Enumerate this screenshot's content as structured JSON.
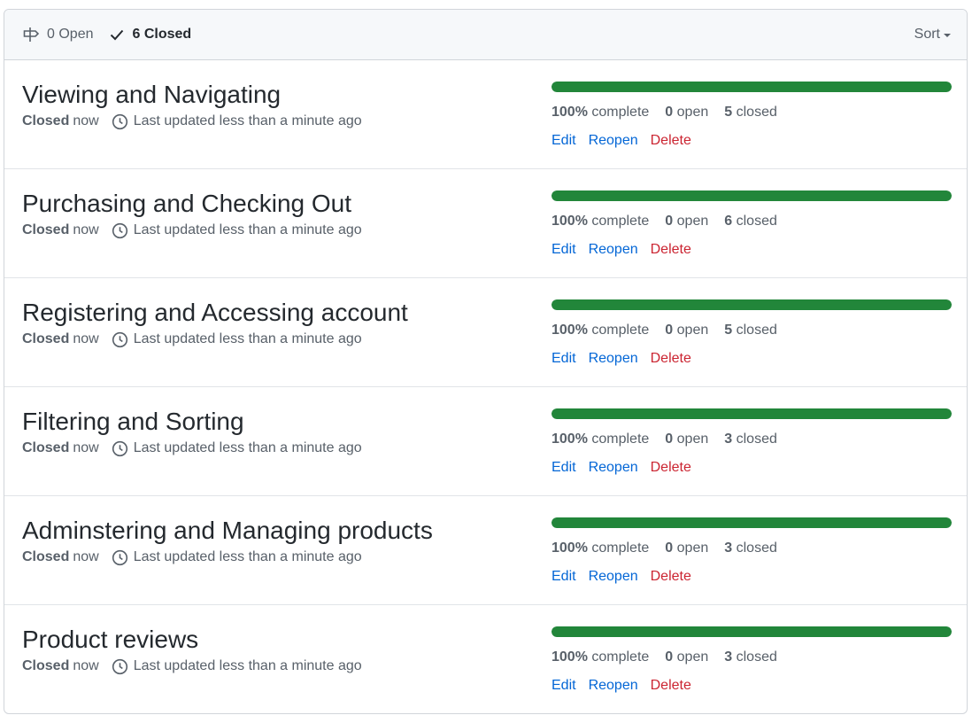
{
  "header": {
    "open_label": "0 Open",
    "closed_label": "6 Closed",
    "sort_label": "Sort"
  },
  "milestones": [
    {
      "title": "Viewing and Navigating",
      "state": "Closed",
      "when": "now",
      "updated": "Last updated less than a minute ago",
      "percent": "100%",
      "percent_word": "complete",
      "open": "0",
      "open_word": "open",
      "closed": "5",
      "closed_word": "closed",
      "progress": 1.0,
      "edit": "Edit",
      "reopen": "Reopen",
      "delete": "Delete"
    },
    {
      "title": "Purchasing and Checking Out",
      "state": "Closed",
      "when": "now",
      "updated": "Last updated less than a minute ago",
      "percent": "100%",
      "percent_word": "complete",
      "open": "0",
      "open_word": "open",
      "closed": "6",
      "closed_word": "closed",
      "progress": 1.0,
      "edit": "Edit",
      "reopen": "Reopen",
      "delete": "Delete"
    },
    {
      "title": "Registering and Accessing account",
      "state": "Closed",
      "when": "now",
      "updated": "Last updated less than a minute ago",
      "percent": "100%",
      "percent_word": "complete",
      "open": "0",
      "open_word": "open",
      "closed": "5",
      "closed_word": "closed",
      "progress": 1.0,
      "edit": "Edit",
      "reopen": "Reopen",
      "delete": "Delete"
    },
    {
      "title": "Filtering and Sorting",
      "state": "Closed",
      "when": "now",
      "updated": "Last updated less than a minute ago",
      "percent": "100%",
      "percent_word": "complete",
      "open": "0",
      "open_word": "open",
      "closed": "3",
      "closed_word": "closed",
      "progress": 1.0,
      "edit": "Edit",
      "reopen": "Reopen",
      "delete": "Delete"
    },
    {
      "title": "Adminstering and Managing products",
      "state": "Closed",
      "when": "now",
      "updated": "Last updated less than a minute ago",
      "percent": "100%",
      "percent_word": "complete",
      "open": "0",
      "open_word": "open",
      "closed": "3",
      "closed_word": "closed",
      "progress": 1.0,
      "edit": "Edit",
      "reopen": "Reopen",
      "delete": "Delete"
    },
    {
      "title": "Product reviews",
      "state": "Closed",
      "when": "now",
      "updated": "Last updated less than a minute ago",
      "percent": "100%",
      "percent_word": "complete",
      "open": "0",
      "open_word": "open",
      "closed": "3",
      "closed_word": "closed",
      "progress": 1.0,
      "edit": "Edit",
      "reopen": "Reopen",
      "delete": "Delete"
    }
  ],
  "colors": {
    "progress": "#22863a",
    "link": "#0366d6",
    "danger": "#cb2431"
  },
  "icons": {
    "open": "milestone-icon",
    "closed": "check-icon",
    "updated": "clock-icon"
  }
}
